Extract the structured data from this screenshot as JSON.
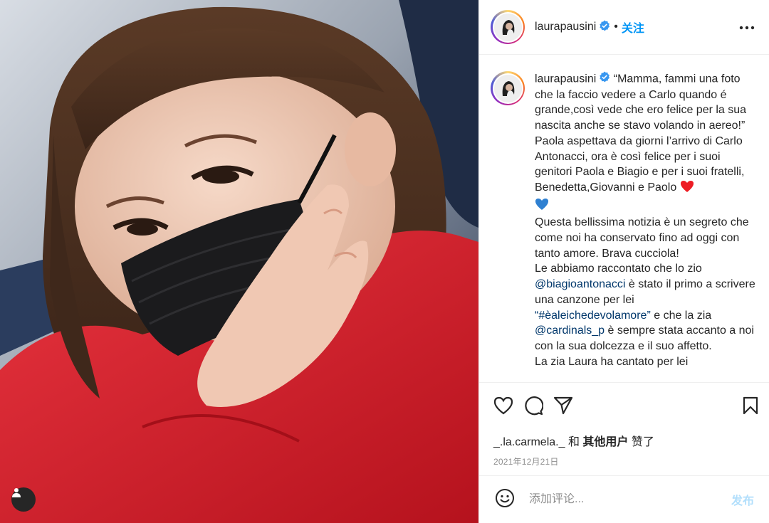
{
  "post": {
    "username": "laurapausini",
    "follow_label": "关注",
    "dot": "•",
    "more_icon": "more-icon",
    "verified_icon": "verified-badge-icon"
  },
  "caption": {
    "username": "laurapausini",
    "p1": "“Mamma, fammi una foto che la faccio vedere a Carlo quando é grande,così vede che ero felice per la sua nascita anche se stavo volando in aereo!”",
    "p2": "Paola aspettava da giorni l’arrivo di Carlo Antonacci, ora è così felice per i suoi genitori Paola e Biagio e per i suoi fratelli, Benedetta,Giovanni e Paolo",
    "p3": "Questa bellissima notizia è un segreto che come noi ha conservato fino ad oggi con tanto amore. Brava cucciola!",
    "p4a": "Le abbiamo raccontato che lo zio",
    "mention1": "@biagioantonacci",
    "p4b": "è stato il primo a scrivere una canzone per lei",
    "hashtag_open": "“",
    "hashtag": "#èaleichedevolamore",
    "hashtag_close": "”",
    "p4c": "e che la zia",
    "mention2": "@cardinals_p",
    "p4d": "è sempre stata accanto a noi con la sua dolcezza e il suo affetto.",
    "p5": "La zia Laura ha cantato per lei"
  },
  "actions": {
    "like_icon": "heart-outline-icon",
    "comment_icon": "comment-icon",
    "share_icon": "share-icon",
    "save_icon": "bookmark-icon",
    "liked_by_user": "_.la.carmela._",
    "liked_and": "和",
    "liked_others": "其他用户",
    "liked_suffix": "赞了",
    "date": "2021年12月21日"
  },
  "comment_box": {
    "emoji_icon": "emoji-icon",
    "placeholder": "添加评论...",
    "post_label": "发布"
  },
  "colors": {
    "link": "#00376b",
    "accent": "#0095f6",
    "post_disabled": "#b2dffc",
    "heart_red": "#ed1c24",
    "heart_blue": "#2f80d1"
  }
}
